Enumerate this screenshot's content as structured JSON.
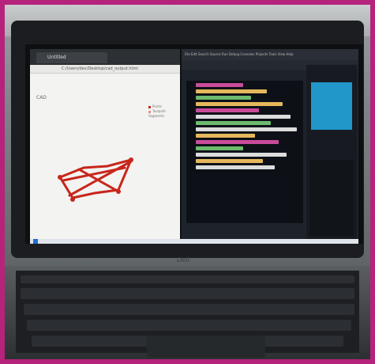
{
  "browser": {
    "tab_title": "Untitled",
    "address": "C:/Users/dev/Desktop/cad_output.html"
  },
  "plot": {
    "label": "CAD",
    "legend": [
      "Points",
      "Toolpath Segments"
    ],
    "accent_color": "#c8261b"
  },
  "ide": {
    "menu": "File Edit Search Source Run Debug Consoles Projects Tools View Help"
  },
  "laptop": {
    "brand": "Dell"
  }
}
